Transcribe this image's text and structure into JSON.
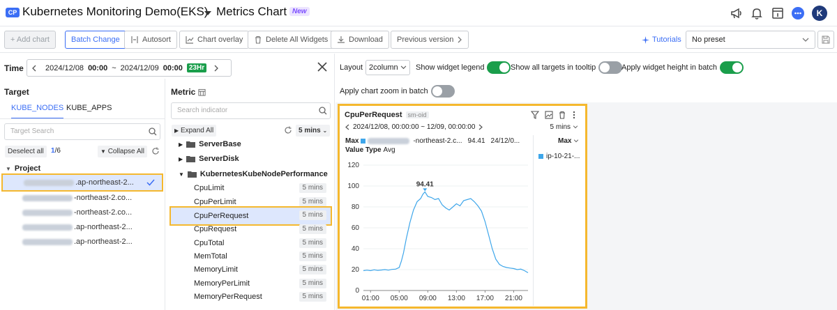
{
  "header": {
    "badge": "CP",
    "project_name": "Kubernetes Monitoring Demo(EKS)",
    "page_title": "Metrics Chart",
    "new_badge": "New",
    "avatar": "K"
  },
  "toolbar": {
    "add_chart": "+ Add chart",
    "batch_change": "Batch Change",
    "autosort": "Autosort",
    "chart_overlay": "Chart overlay",
    "delete_all": "Delete All Widgets",
    "download": "Download",
    "previous_version": "Previous version",
    "tutorials": "Tutorials",
    "preset_value": "No preset"
  },
  "time": {
    "label": "Time",
    "start_date": "2024/12/08",
    "start_time": "00:00",
    "sep": "~",
    "end_date": "2024/12/09",
    "end_time": "00:00",
    "range_badge": "23Hr"
  },
  "target": {
    "title": "Target",
    "tabs": [
      "KUBE_NODES",
      "KUBE_APPS"
    ],
    "search_placeholder": "Target Search",
    "deselect_all": "Deselect all",
    "selected_count": "1",
    "total_count": "/6",
    "collapse_all": "Collapse All",
    "group": "Project",
    "items": [
      {
        "suffix": ".ap-northeast-2...",
        "selected": true
      },
      {
        "suffix": "-northeast-2.co...",
        "selected": false
      },
      {
        "suffix": "-northeast-2.co...",
        "selected": false
      },
      {
        "suffix": ".ap-northeast-2...",
        "selected": false
      },
      {
        "suffix": ".ap-northeast-2...",
        "selected": false
      }
    ]
  },
  "metric": {
    "title": "Metric",
    "search_placeholder": "Search indicator",
    "expand_all": "Expand All",
    "interval": "5 mins",
    "folders": [
      "ServerBase",
      "ServerDisk",
      "KubernetesKubeNodePerformance"
    ],
    "items": [
      {
        "name": "CpuLimit",
        "interval": "5 mins"
      },
      {
        "name": "CpuPerLimit",
        "interval": "5 mins"
      },
      {
        "name": "CpuPerRequest",
        "interval": "5 mins",
        "selected": true
      },
      {
        "name": "CpuRequest",
        "interval": "5 mins"
      },
      {
        "name": "CpuTotal",
        "interval": "5 mins"
      },
      {
        "name": "MemTotal",
        "interval": "5 mins"
      },
      {
        "name": "MemoryLimit",
        "interval": "5 mins"
      },
      {
        "name": "MemoryPerLimit",
        "interval": "5 mins"
      },
      {
        "name": "MemoryPerRequest",
        "interval": "5 mins"
      }
    ]
  },
  "options": {
    "layout_label": "Layout",
    "layout_value": "2column",
    "show_legend": "Show widget legend",
    "show_all_targets": "Show all targets in tooltip",
    "apply_height": "Apply widget height in batch",
    "apply_zoom": "Apply chart zoom in batch"
  },
  "widget": {
    "title": "CpuPerRequest",
    "tag": "sm-oid",
    "time_range": "2024/12/08, 00:00:00 ~ 12/09, 00:00:00",
    "interval": "5 mins",
    "max_label": "Max",
    "max_target": "-northeast-2.c...",
    "max_value": "94.41",
    "max_time": "24/12/0...",
    "value_type_label": "Value Type",
    "value_type": "Avg",
    "legend_header": "Max",
    "legend_item": "ip-10-21-...",
    "series_color": "#3ea6ea"
  },
  "chart_data": {
    "type": "line",
    "title": "CpuPerRequest",
    "ylim": [
      0,
      120
    ],
    "yticks": [
      0,
      20,
      40,
      60,
      80,
      100,
      120
    ],
    "xticks": [
      "01:00",
      "05:00",
      "09:00",
      "13:00",
      "17:00",
      "21:00"
    ],
    "xlim_hours": [
      0,
      23
    ],
    "peak": {
      "x": 8.6,
      "y": 94.41,
      "label": "94.41"
    },
    "series": [
      {
        "x": [
          0,
          0.5,
          1,
          1.5,
          2,
          2.5,
          3,
          3.5,
          4,
          4.5,
          5,
          5.3,
          5.6,
          6,
          6.5,
          7,
          7.5,
          8,
          8.3,
          8.6,
          9,
          9.5,
          10,
          10.5,
          11,
          11.5,
          12,
          12.5,
          13,
          13.5,
          14,
          14.5,
          15,
          15.5,
          16,
          16.5,
          17,
          17.5,
          18,
          18.5,
          19,
          19.5,
          20,
          20.5,
          21,
          21.5,
          22,
          22.5,
          23
        ],
        "y": [
          19,
          19.5,
          19,
          19.8,
          19.3,
          19.6,
          20,
          19.5,
          20.2,
          20.5,
          22,
          28,
          36,
          50,
          65,
          77,
          85,
          88,
          92,
          94.41,
          90,
          89,
          87,
          88,
          82,
          79,
          77,
          80,
          83,
          81,
          86,
          87,
          88,
          85,
          81,
          76,
          66,
          53,
          40,
          30,
          25,
          23,
          22,
          21.5,
          21,
          20,
          20.5,
          19,
          17
        ]
      }
    ]
  }
}
